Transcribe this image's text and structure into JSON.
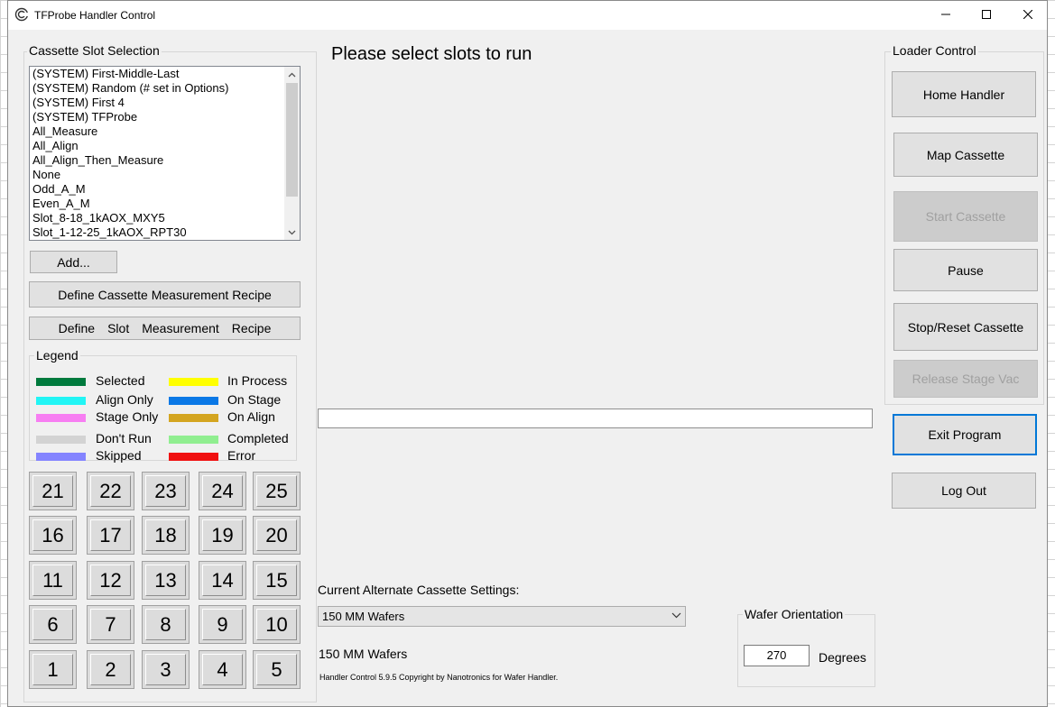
{
  "window": {
    "title": "TFProbe Handler Control"
  },
  "cassette": {
    "group_title": "Cassette Slot Selection",
    "items": [
      "(SYSTEM) First-Middle-Last",
      "(SYSTEM) Random (# set in Options)",
      "(SYSTEM) First 4",
      "(SYSTEM) TFProbe",
      "All_Measure",
      "All_Align",
      "All_Align_Then_Measure",
      "None",
      "Odd_A_M",
      "Even_A_M",
      "Slot_8-18_1kAOX_MXY5",
      "Slot_1-12-25_1kAOX_RPT30"
    ],
    "add_label": "Add...",
    "define_cassette_label": "Define Cassette Measurement Recipe",
    "define_slot_words": [
      "Define",
      "Slot",
      "Measurement",
      "Recipe"
    ]
  },
  "legend": {
    "title": "Legend",
    "items": [
      {
        "label": "Selected",
        "color": "#007a3d"
      },
      {
        "label": "In Process",
        "color": "#ffff00"
      },
      {
        "label": "Align Only",
        "color": "#22f5f5"
      },
      {
        "label": "On Stage",
        "color": "#0a78e6"
      },
      {
        "label": "Stage Only",
        "color": "#f77ef2"
      },
      {
        "label": "On Align",
        "color": "#d4a520"
      },
      {
        "label": "Don't Run",
        "color": "#d3d3d3"
      },
      {
        "label": "Completed",
        "color": "#90ee90"
      },
      {
        "label": "Skipped",
        "color": "#8484ff"
      },
      {
        "label": "Error",
        "color": "#f01010"
      }
    ]
  },
  "slots": {
    "rows": [
      [
        "21",
        "22",
        "23",
        "24",
        "25"
      ],
      [
        "16",
        "17",
        "18",
        "19",
        "20"
      ],
      [
        "11",
        "12",
        "13",
        "14",
        "15"
      ],
      [
        "6",
        "7",
        "8",
        "9",
        "10"
      ],
      [
        "1",
        "2",
        "3",
        "4",
        "5"
      ]
    ]
  },
  "main": {
    "title": "Please select slots to run",
    "alt_settings_label": "Current Alternate Cassette Settings:",
    "alt_settings_value": "150 MM Wafers",
    "wafer_desc": "150 MM Wafers",
    "copyright": "Handler Control 5.9.5 Copyright by Nanotronics for Wafer Handler."
  },
  "orientation": {
    "title": "Wafer Orientation",
    "value": "270",
    "unit": "Degrees"
  },
  "loader": {
    "title": "Loader Control",
    "home": "Home Handler",
    "map": "Map Cassette",
    "start": "Start Cassette",
    "pause": "Pause",
    "stop": "Stop/Reset Cassette",
    "release": "Release Stage Vac"
  },
  "actions": {
    "exit": "Exit Program",
    "logout": "Log Out"
  }
}
